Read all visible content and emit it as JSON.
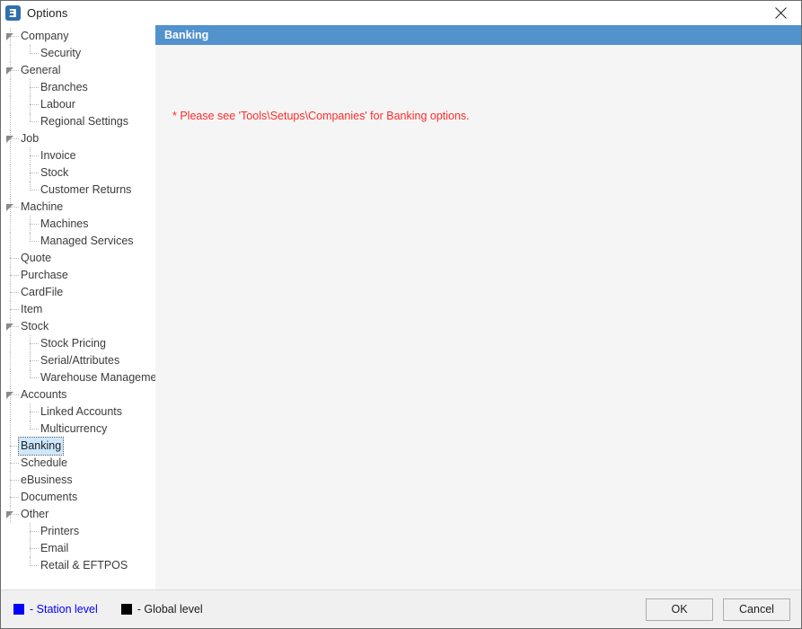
{
  "window": {
    "title": "Options",
    "app_icon": "options-app-icon",
    "close_icon": "close-icon"
  },
  "tree": {
    "selected": "Banking",
    "nodes": [
      {
        "label": "Company",
        "level": 0,
        "expandable": true,
        "expanded": true
      },
      {
        "label": "Security",
        "level": 1,
        "expandable": false,
        "last": true
      },
      {
        "label": "General",
        "level": 0,
        "expandable": true,
        "expanded": true
      },
      {
        "label": "Branches",
        "level": 1,
        "expandable": false
      },
      {
        "label": "Labour",
        "level": 1,
        "expandable": false
      },
      {
        "label": "Regional Settings",
        "level": 1,
        "expandable": false,
        "last": true
      },
      {
        "label": "Job",
        "level": 0,
        "expandable": true,
        "expanded": true
      },
      {
        "label": "Invoice",
        "level": 1,
        "expandable": false
      },
      {
        "label": "Stock",
        "level": 1,
        "expandable": false
      },
      {
        "label": "Customer Returns",
        "level": 1,
        "expandable": false,
        "last": true
      },
      {
        "label": "Machine",
        "level": 0,
        "expandable": true,
        "expanded": true
      },
      {
        "label": "Machines",
        "level": 1,
        "expandable": false
      },
      {
        "label": "Managed Services",
        "level": 1,
        "expandable": false,
        "last": true
      },
      {
        "label": "Quote",
        "level": 0,
        "expandable": false
      },
      {
        "label": "Purchase",
        "level": 0,
        "expandable": false
      },
      {
        "label": "CardFile",
        "level": 0,
        "expandable": false
      },
      {
        "label": "Item",
        "level": 0,
        "expandable": false
      },
      {
        "label": "Stock",
        "level": 0,
        "expandable": true,
        "expanded": true
      },
      {
        "label": "Stock Pricing",
        "level": 1,
        "expandable": false
      },
      {
        "label": "Serial/Attributes",
        "level": 1,
        "expandable": false
      },
      {
        "label": "Warehouse Management",
        "level": 1,
        "expandable": false,
        "last": true
      },
      {
        "label": "Accounts",
        "level": 0,
        "expandable": true,
        "expanded": true
      },
      {
        "label": "Linked Accounts",
        "level": 1,
        "expandable": false
      },
      {
        "label": "Multicurrency",
        "level": 1,
        "expandable": false,
        "last": true
      },
      {
        "label": "Banking",
        "level": 0,
        "expandable": false,
        "selected": true
      },
      {
        "label": "Schedule",
        "level": 0,
        "expandable": false
      },
      {
        "label": "eBusiness",
        "level": 0,
        "expandable": false
      },
      {
        "label": "Documents",
        "level": 0,
        "expandable": false
      },
      {
        "label": "Other",
        "level": 0,
        "expandable": true,
        "expanded": true
      },
      {
        "label": "Printers",
        "level": 1,
        "expandable": false
      },
      {
        "label": "Email",
        "level": 1,
        "expandable": false
      },
      {
        "label": "Retail & EFTPOS",
        "level": 1,
        "expandable": false,
        "last": true
      }
    ]
  },
  "content": {
    "header_title": "Banking",
    "notice": "* Please see 'Tools\\Setups\\Companies' for Banking options."
  },
  "footer": {
    "legend": [
      {
        "label": "- Station level",
        "color": "#0000ff",
        "name": "station-level"
      },
      {
        "label": "- Global level",
        "color": "#000000",
        "name": "global-level"
      }
    ],
    "buttons": [
      {
        "label": "OK",
        "name": "ok-button"
      },
      {
        "label": "Cancel",
        "name": "cancel-button"
      }
    ]
  },
  "colors": {
    "accent": "#5292cd",
    "selection": "#cde8ff",
    "notice": "#ff2a2a",
    "panel_bg": "#f5f5f5",
    "footer_bg": "#f0f0f0"
  }
}
